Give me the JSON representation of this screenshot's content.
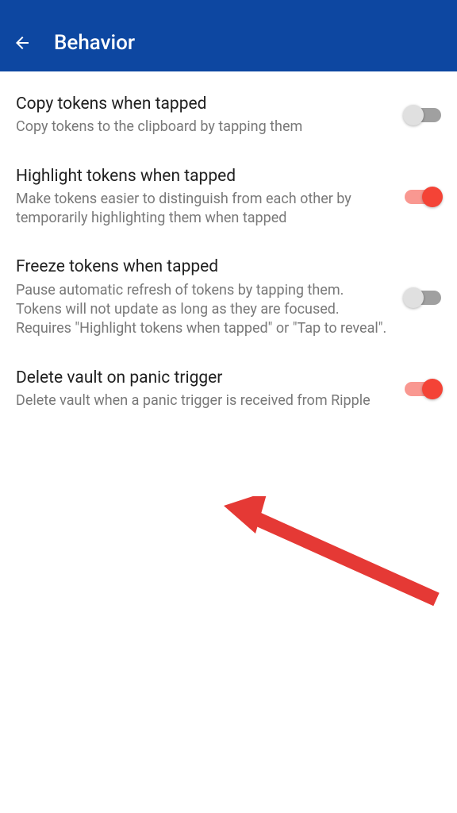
{
  "header": {
    "title": "Behavior"
  },
  "settings": [
    {
      "title": "Copy tokens when tapped",
      "description": "Copy tokens to the clipboard by tapping them",
      "enabled": false
    },
    {
      "title": "Highlight tokens when tapped",
      "description": "Make tokens easier to distinguish from each other by temporarily highlighting them when tapped",
      "enabled": true
    },
    {
      "title": "Freeze tokens when tapped",
      "description": "Pause automatic refresh of tokens by tapping them. Tokens will not update as long as they are focused. Requires \"Highlight tokens when tapped\" or \"Tap to reveal\".",
      "enabled": false
    },
    {
      "title": "Delete vault on panic trigger",
      "description": "Delete vault when a panic trigger is received from Ripple",
      "enabled": true
    }
  ],
  "colors": {
    "primary": "#0d47a1",
    "accent": "#f44336"
  }
}
